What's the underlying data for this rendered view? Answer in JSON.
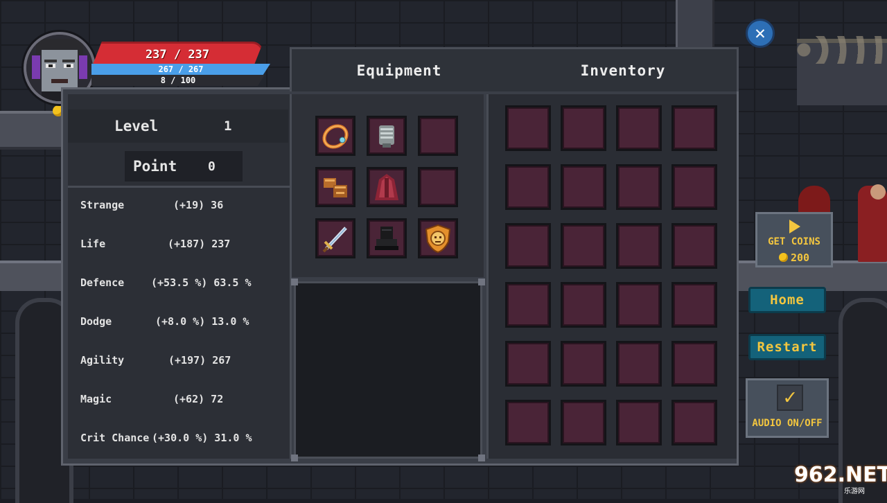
{
  "hud": {
    "hp": "237 / 237",
    "mp": "267 / 267",
    "xp": "8 / 100"
  },
  "tabs": {
    "equipment": "Equipment",
    "inventory": "Inventory"
  },
  "character": {
    "level_label": "Level",
    "level_value": "1",
    "point_label": "Point",
    "point_value": "0"
  },
  "stats": [
    {
      "name": "Strange",
      "value": "(+19) 36"
    },
    {
      "name": "Life",
      "value": "(+187) 237"
    },
    {
      "name": "Defence",
      "value": "(+53.5 %) 63.5 %"
    },
    {
      "name": "Dodge",
      "value": "(+8.0 %) 13.0 %"
    },
    {
      "name": "Agility",
      "value": "(+197) 267"
    },
    {
      "name": "Magic",
      "value": "(+62) 72"
    },
    {
      "name": "Crit Chance",
      "value": "(+30.0 %) 31.0 %"
    }
  ],
  "equipment_slots": [
    {
      "item": "ring-icon"
    },
    {
      "item": "armor-icon"
    },
    {
      "item": "empty"
    },
    {
      "item": "gloves-icon"
    },
    {
      "item": "cloak-icon"
    },
    {
      "item": "empty"
    },
    {
      "item": "sword-icon"
    },
    {
      "item": "boots-icon"
    },
    {
      "item": "shield-icon"
    }
  ],
  "side": {
    "get_coins": "GET COINS",
    "coins_amount": "200",
    "home": "Home",
    "restart": "Restart",
    "audio": "AUDIO ON/OFF",
    "audio_check": "✓"
  },
  "watermark": {
    "brand": "962.NET",
    "sub": "乐游网"
  },
  "colors": {
    "slot_fill": "#4a2437",
    "accent_gold": "#f3c63f",
    "hp_red": "#d52d35",
    "mp_blue": "#4a9ee8",
    "button_teal": "#14627a"
  }
}
